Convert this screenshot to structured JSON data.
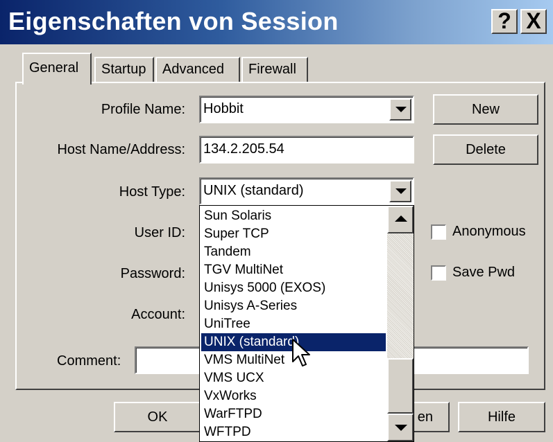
{
  "window": {
    "title": "Eigenschaften von Session",
    "help_label": "?",
    "close_label": "X"
  },
  "tabs": [
    {
      "label": "General",
      "active": true
    },
    {
      "label": "Startup",
      "active": false
    },
    {
      "label": "Advanced",
      "active": false
    },
    {
      "label": "Firewall",
      "active": false
    }
  ],
  "form": {
    "profile_name_label": "Profile Name:",
    "profile_name_value": "Hobbit",
    "host_label": "Host Name/Address:",
    "host_value": "134.2.205.54",
    "host_type_label": "Host Type:",
    "host_type_value": "UNIX (standard)",
    "user_id_label": "User ID:",
    "password_label": "Password:",
    "account_label": "Account:",
    "comment_label": "Comment:",
    "anonymous_label": "Anonymous",
    "save_pwd_label": "Save Pwd"
  },
  "side_buttons": {
    "new_label": "New",
    "delete_label": "Delete"
  },
  "host_type_options": [
    "Sun Solaris",
    "Super TCP",
    "Tandem",
    "TGV MultiNet",
    "Unisys 5000 (EXOS)",
    "Unisys A-Series",
    "UniTree",
    "UNIX (standard)",
    "VMS MultiNet",
    "VMS UCX",
    "VxWorks",
    "WarFTPD",
    "WFTPD"
  ],
  "selected_option_index": 7,
  "bottom_buttons": {
    "ok_label": "OK",
    "partial_label": "en",
    "help_label": "Hilfe"
  }
}
